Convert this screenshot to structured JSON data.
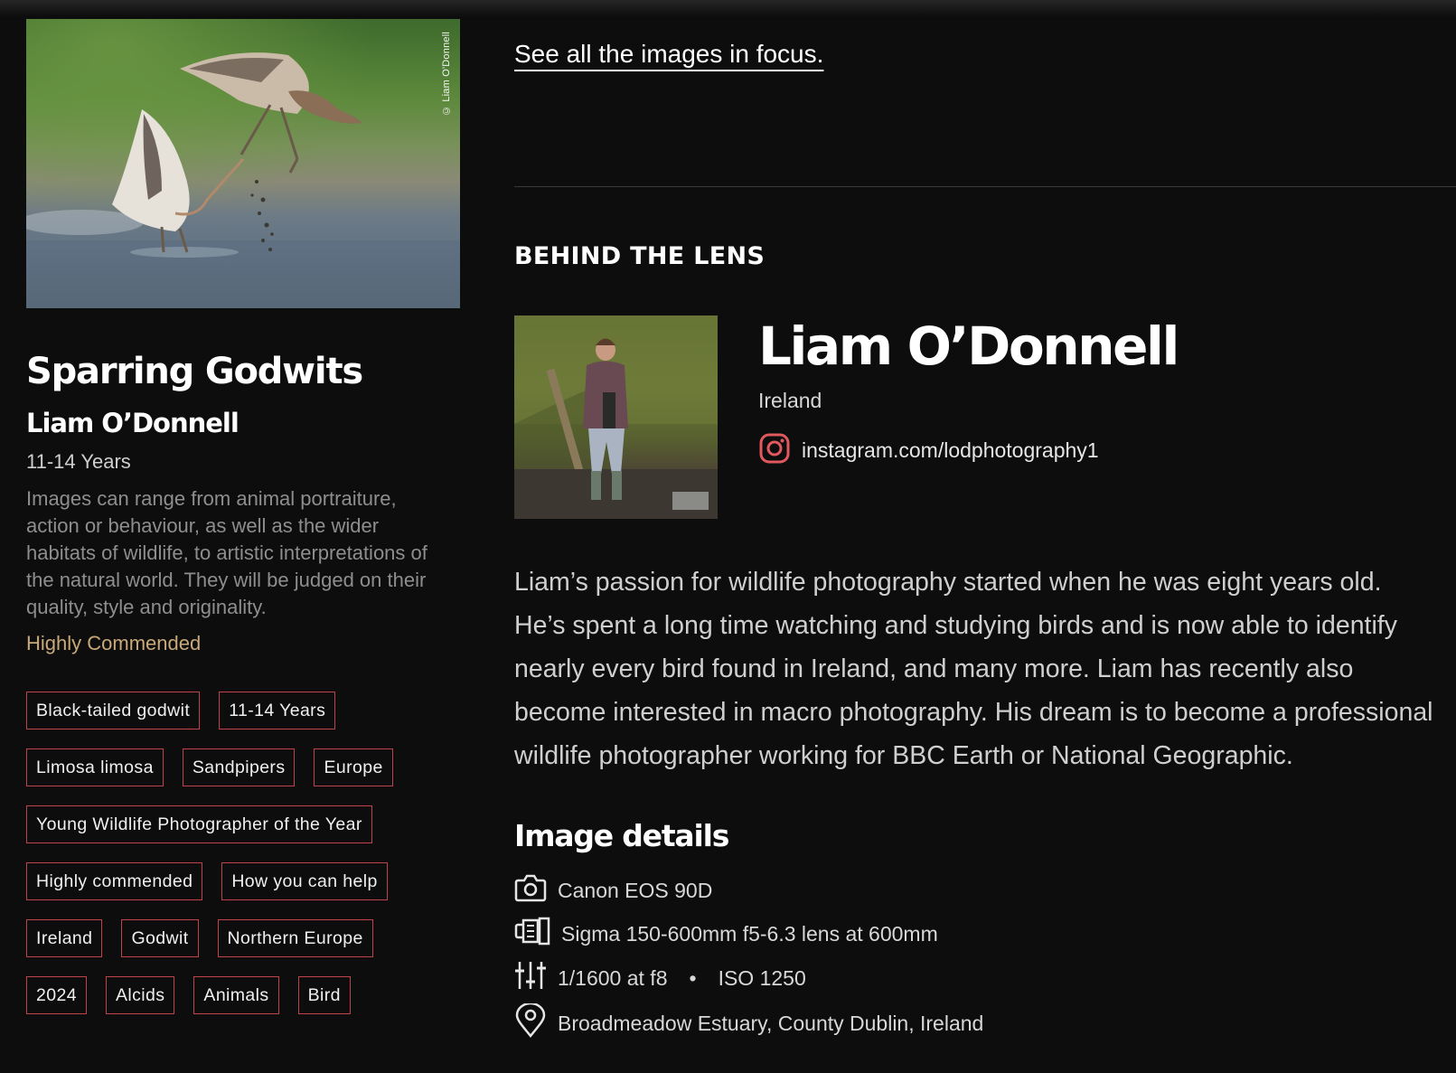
{
  "artwork": {
    "credit": "© Liam O'Donnell",
    "title": "Sparring Godwits",
    "author": "Liam O’Donnell",
    "category": "11-14 Years",
    "description": "Images can range from animal portraiture, action or behaviour, as well as the wider habitats of wildlife, to artistic interpretations of the natural world. They will be judged on their quality, style and originality.",
    "award": "Highly Commended",
    "award_color": "#c9a97a"
  },
  "tags": {
    "rows": [
      [
        "Black-tailed godwit",
        "11-14 Years"
      ],
      [
        "Limosa limosa",
        "Sandpipers",
        "Europe"
      ],
      [
        "Young Wildlife Photographer of the Year"
      ],
      [
        "Highly commended",
        "How you can help"
      ],
      [
        "Ireland",
        "Godwit",
        "Northern Europe"
      ],
      [
        "2024",
        "Alcids",
        "Animals",
        "Bird"
      ]
    ],
    "border_color": "#c0424b"
  },
  "focus": {
    "link_text": "See all the images in focus."
  },
  "behind_the_lens": {
    "heading": "BEHIND THE LENS",
    "name": "Liam O’Donnell",
    "country": "Ireland",
    "instagram": "instagram.com/lodphotography1",
    "instagram_icon": "instagram-icon",
    "bio": "Liam’s passion for wildlife photography started when he was eight years old. He’s spent a long time watching and studying birds and is now able to identify nearly every bird found in Ireland, and many more. Liam has recently also become interested in macro photography. His dream is to become a professional wildlife photographer working for BBC Earth or National Geographic."
  },
  "image_details": {
    "heading": "Image details",
    "camera": "Canon EOS 90D",
    "lens": "Sigma 150-600mm f5-6.3 lens at 600mm",
    "exposure": "1/1600 at f8",
    "iso": "ISO 1250",
    "location": "Broadmeadow Estuary, County Dublin, Ireland",
    "icons": [
      "camera-icon",
      "lens-icon",
      "settings-sliders-icon",
      "location-pin-icon"
    ]
  },
  "colors": {
    "background": "#0d0d0d",
    "accent": "#c0424b",
    "instagram": "#e1585f"
  }
}
